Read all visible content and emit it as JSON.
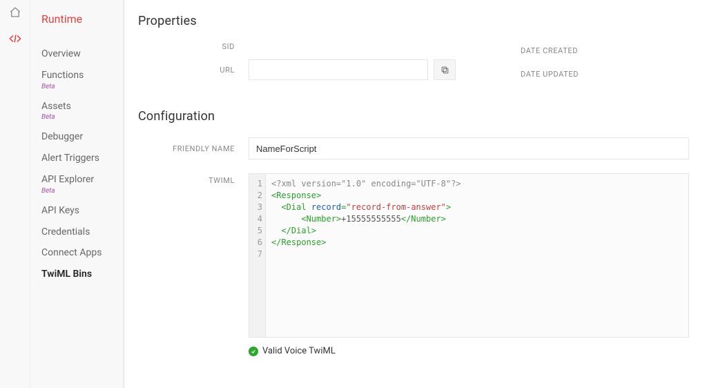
{
  "icon_rail": {
    "home": "home-icon",
    "code": "code-icon"
  },
  "sidebar": {
    "title": "Runtime",
    "items": [
      {
        "label": "Overview",
        "beta": ""
      },
      {
        "label": "Functions",
        "beta": "Beta"
      },
      {
        "label": "Assets",
        "beta": "Beta"
      },
      {
        "label": "Debugger",
        "beta": ""
      },
      {
        "label": "Alert Triggers",
        "beta": ""
      },
      {
        "label": "API Explorer",
        "beta": "Beta"
      },
      {
        "label": "API Keys",
        "beta": ""
      },
      {
        "label": "Credentials",
        "beta": ""
      },
      {
        "label": "Connect Apps",
        "beta": ""
      },
      {
        "label": "TwiML Bins",
        "beta": ""
      }
    ],
    "active_index": 9
  },
  "properties": {
    "section_title": "Properties",
    "sid_label": "SID",
    "sid_value": "",
    "url_label": "URL",
    "url_value": "",
    "date_created_label": "DATE CREATED",
    "date_created_value": "",
    "date_updated_label": "DATE UPDATED",
    "date_updated_value": ""
  },
  "config": {
    "section_title": "Configuration",
    "friendly_name_label": "FRIENDLY NAME",
    "friendly_name_value": "NameForScript",
    "twiml_label": "TWIML",
    "code": {
      "l1_decl": "<?xml version=\"1.0\" encoding=\"UTF-8\"?>",
      "l2_open": "<Response>",
      "l3_indent": "  ",
      "l3_open1": "<Dial",
      "l3_space": " ",
      "l3_attr": "record",
      "l3_eq": "=",
      "l3_val": "\"record-from-answer\"",
      "l3_close": ">",
      "l4_indent": "      ",
      "l4_open": "<Number>",
      "l4_text": "+15555555555",
      "l4_close": "</Number>",
      "l5_indent": "  ",
      "l5_close": "</Dial>",
      "l6_close": "</Response>"
    },
    "valid_text": "Valid Voice TwiML"
  }
}
